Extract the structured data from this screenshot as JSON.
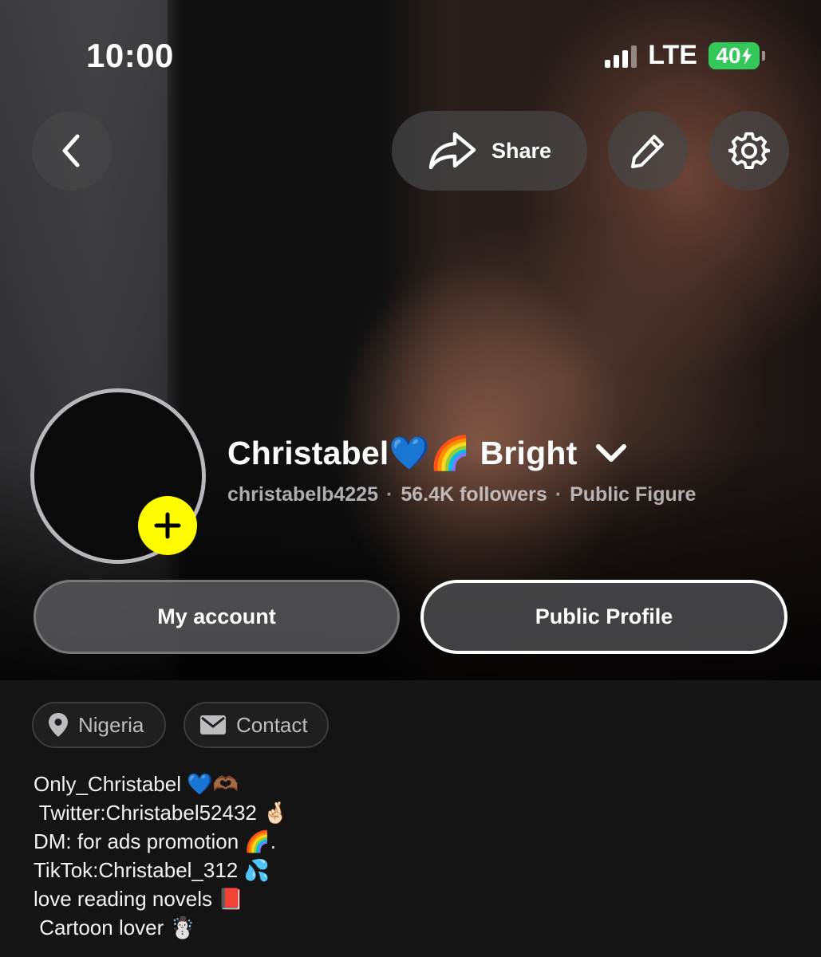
{
  "status_bar": {
    "time": "10:00",
    "network": "LTE",
    "battery": "40"
  },
  "header": {
    "back_icon": "chevron-left-icon",
    "share_label": "Share",
    "share_icon": "share-arrow-icon",
    "edit_icon": "pencil-icon",
    "settings_icon": "gear-icon"
  },
  "profile": {
    "display_name": "Christabel💙🌈 Bright",
    "username": "christabelb4225",
    "separator": "·",
    "followers": "56.4K followers",
    "category": "Public Figure",
    "add_story_color": "#fffc00"
  },
  "actions": {
    "my_account": "My account",
    "public_profile": "Public Profile"
  },
  "chips": {
    "location": "Nigeria",
    "contact": "Contact"
  },
  "bio": [
    "Only_Christabel 💙🫶🏾",
    " Twitter:Christabel52432 🤞🏻",
    "DM: for ads promotion 🌈.",
    "TikTok:Christabel_312 💦",
    "love reading novels 📕",
    " Cartoon lover ☃️"
  ],
  "colors": {
    "background": "#141414",
    "battery_green": "#34c759",
    "accent_yellow": "#fffc00"
  }
}
